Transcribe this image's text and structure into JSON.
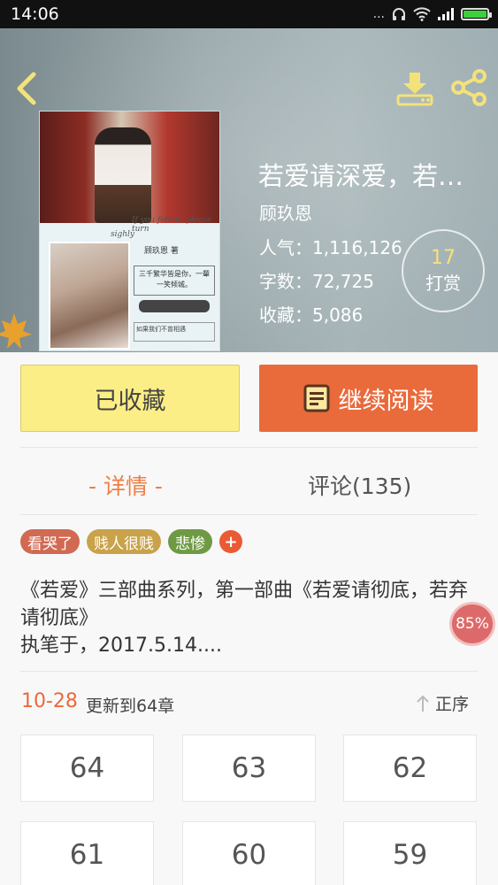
{
  "status_bar": {
    "time": "14:06",
    "dots": "...",
    "battery_level": 1.0
  },
  "book": {
    "title": "若爱请深爱，若弃请彻底",
    "author": "顾玖恩",
    "stats": [
      {
        "label": "人气：1,116,126"
      },
      {
        "label": "字数：72,725"
      },
      {
        "label": "收藏：5,086"
      }
    ],
    "tip": {
      "count": "17",
      "label": "打赏"
    }
  },
  "cover": {
    "script_line": "If you follow, please turn",
    "script_line2": "sighly",
    "author_line": "顾玖恩 著",
    "box_text": "三千繁华皆是你，一颦一笑倾城。",
    "bottom_text": "如果我们不曾相遇"
  },
  "actions": {
    "collect": "已收藏",
    "continue_read": "继续阅读"
  },
  "tabs": {
    "detail": "- 详情 -",
    "comments": "评论(135)"
  },
  "tags": [
    {
      "label": "看哭了",
      "color": "#d16a52"
    },
    {
      "label": "贱人很贱",
      "color": "#c9a24a"
    },
    {
      "label": "悲惨",
      "color": "#6f9a44"
    }
  ],
  "tag_add": "+",
  "description": {
    "line1": "《若爱》三部曲系列，第一部曲《若爱请彻底，若弃请彻底》",
    "line2": "执笔于，2017.5.14...."
  },
  "progress": "85%",
  "update": {
    "date": "10-28",
    "text": "更新到64章",
    "sort": "正序"
  },
  "chapters": [
    "64",
    "63",
    "62",
    "61",
    "60",
    "59"
  ],
  "colors": {
    "accent": "#e96a3b",
    "collect_bg": "#fcee86",
    "icon_yellow": "#f3e27a"
  }
}
